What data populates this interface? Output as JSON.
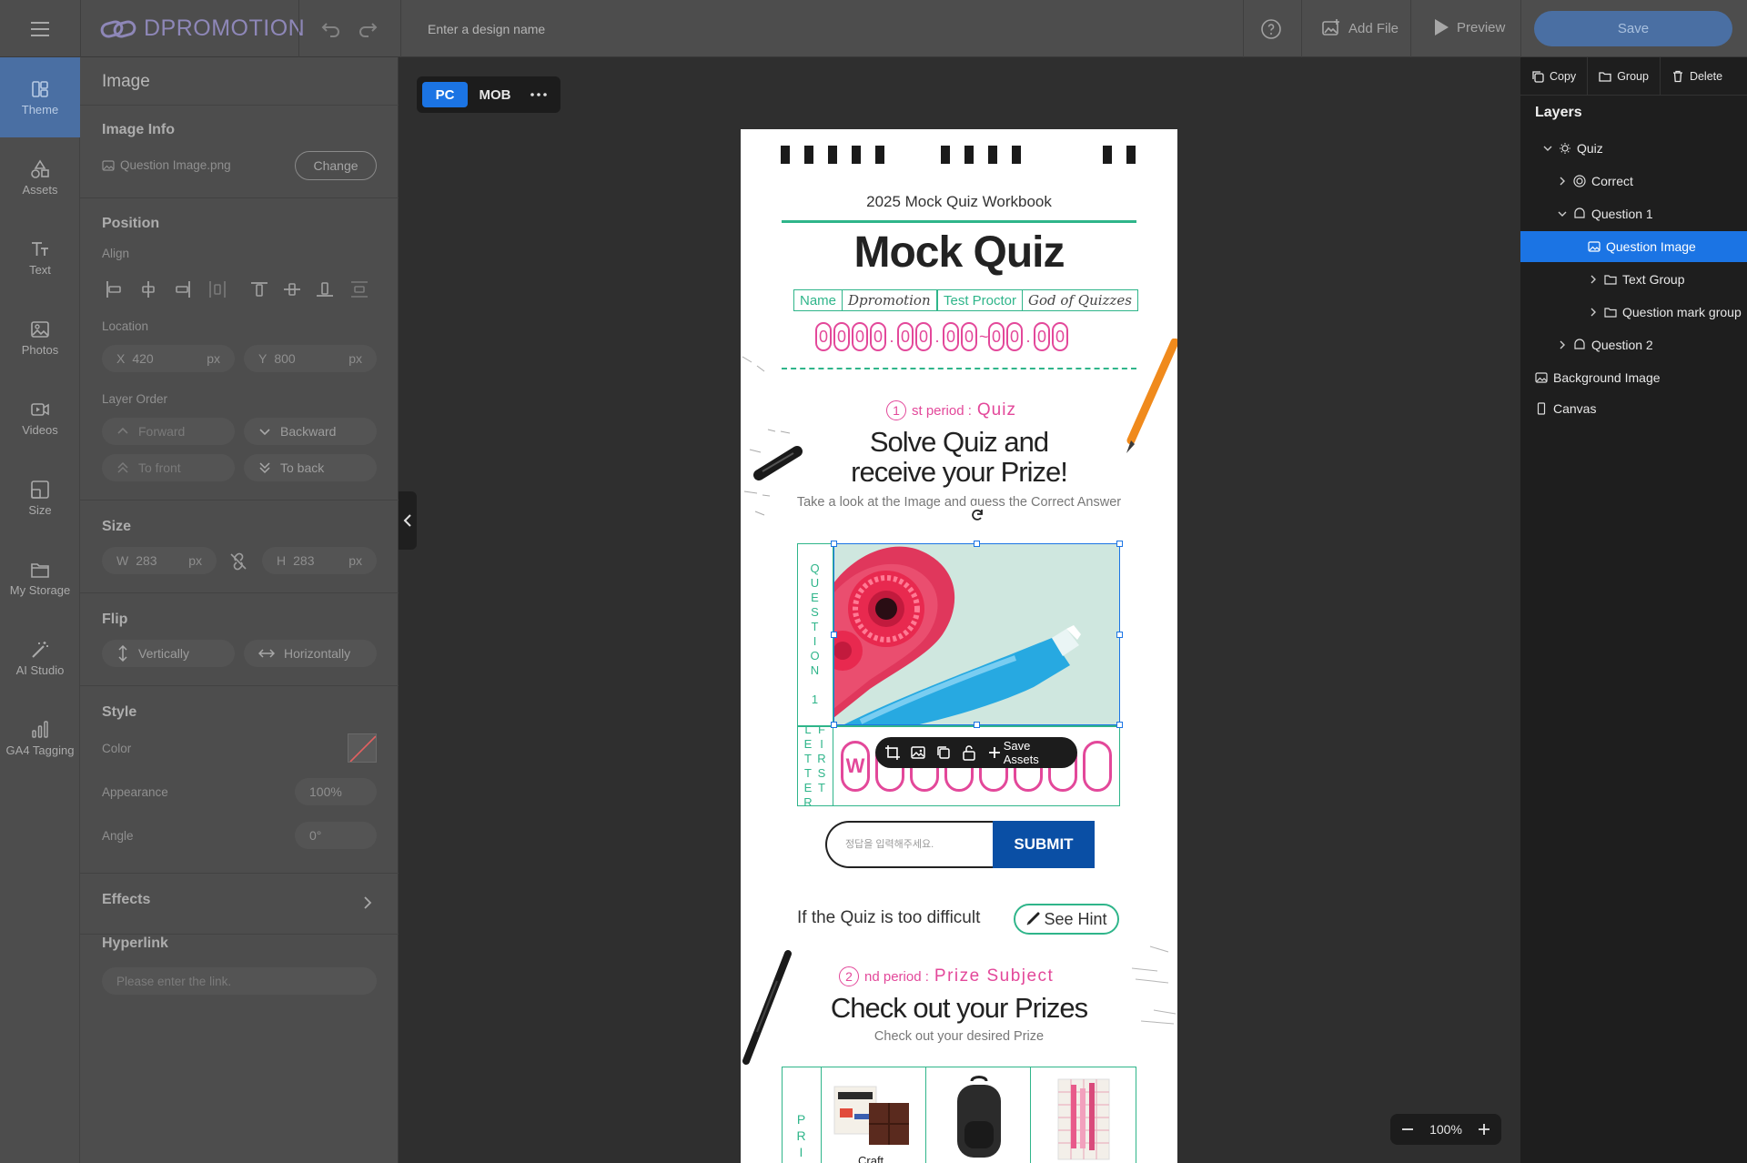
{
  "topbar": {
    "logo_text": "DPROMOTION",
    "design_name_placeholder": "Enter a design name",
    "add_file_label": "Add File",
    "preview_label": "Preview",
    "save_label": "Save"
  },
  "rail": {
    "items": [
      {
        "label": "Theme",
        "icon": "theme-icon"
      },
      {
        "label": "Assets",
        "icon": "assets-icon"
      },
      {
        "label": "Text",
        "icon": "text-icon"
      },
      {
        "label": "Photos",
        "icon": "photos-icon"
      },
      {
        "label": "Videos",
        "icon": "videos-icon"
      },
      {
        "label": "Size",
        "icon": "size-icon"
      },
      {
        "label": "My Storage",
        "icon": "folder-icon"
      },
      {
        "label": "AI Studio",
        "icon": "magic-wand-icon"
      },
      {
        "label": "GA4 Tagging",
        "icon": "bar-chart-icon"
      }
    ],
    "active_index": 0
  },
  "panel": {
    "title": "Image",
    "image_info": {
      "section": "Image Info",
      "file_name": "Question Image.png",
      "change_label": "Change"
    },
    "position": {
      "section": "Position",
      "align_label": "Align",
      "location_label": "Location",
      "x_key": "X",
      "x_value": "420",
      "x_unit": "px",
      "y_key": "Y",
      "y_value": "800",
      "y_unit": "px",
      "layer_order_label": "Layer Order",
      "forward_label": "Forward",
      "backward_label": "Backward",
      "to_front_label": "To front",
      "to_back_label": "To back"
    },
    "size": {
      "section": "Size",
      "w_key": "W",
      "w_value": "283",
      "w_unit": "px",
      "h_key": "H",
      "h_value": "283",
      "h_unit": "px"
    },
    "flip": {
      "section": "Flip",
      "vertical_label": "Vertically",
      "horizontal_label": "Horizontally"
    },
    "style": {
      "section": "Style",
      "color_label": "Color",
      "appearance_label": "Appearance",
      "appearance_value": "100%",
      "angle_label": "Angle",
      "angle_value": "0°"
    },
    "effects_label": "Effects",
    "hyperlink": {
      "section": "Hyperlink",
      "placeholder": "Please enter the link."
    }
  },
  "device": {
    "pc_label": "PC",
    "mob_label": "MOB"
  },
  "canvas": {
    "workbook": "2025 Mock Quiz Workbook",
    "title": "Mock Quiz",
    "name_label": "Name",
    "name_value": "Dpromotion",
    "proctor_label": "Test Proctor",
    "proctor_value": "God of Quizzes",
    "date_groups": [
      [
        "0",
        "0",
        "0",
        "0"
      ],
      [
        "0",
        "0"
      ],
      [
        "0",
        "0"
      ],
      [
        "0",
        "0"
      ],
      [
        "0",
        "0"
      ]
    ],
    "date_seps": [
      ".",
      ".",
      "~",
      "."
    ],
    "period1_num": "1",
    "period1_small": "st period :",
    "period1_big": "Quiz",
    "headline_1": "Solve Quiz and",
    "headline_2": "receive your Prize!",
    "take_look": "Take a look at the Image and guess the Correct Answer",
    "question_vertical": "QUESTION 1",
    "first_letter_vertical": "FIRST LETTER",
    "first_letter": "W",
    "save_assets_label": "Save Assets",
    "answer_placeholder": "정답을 입력해주세요.",
    "submit_label": "SUBMIT",
    "difficult_text": "If the Quiz is too difficult",
    "hint_label": "See Hint",
    "period2_num": "2",
    "period2_small": "nd period :",
    "period2_big": "Prize Subject",
    "checkout_title": "Check out your Prizes",
    "checkout_sub": "Check out your desired Prize",
    "prize_vertical": "PRIZ",
    "prize_1_label": "Craft"
  },
  "zoom": {
    "value": "100%"
  },
  "layers_panel": {
    "copy_label": "Copy",
    "group_label": "Group",
    "delete_label": "Delete",
    "title": "Layers",
    "items": [
      {
        "label": "Quiz",
        "icon": "bulb-icon"
      },
      {
        "label": "Correct",
        "icon": "target-icon"
      },
      {
        "label": "Question 1",
        "icon": "chat-icon"
      },
      {
        "label": "Question Image",
        "icon": "image-icon"
      },
      {
        "label": "Text Group",
        "icon": "folder-icon"
      },
      {
        "label": "Question mark group",
        "icon": "folder-icon"
      },
      {
        "label": "Question 2",
        "icon": "chat-icon"
      },
      {
        "label": "Background Image",
        "icon": "image-icon"
      },
      {
        "label": "Canvas",
        "icon": "rectangle-icon"
      }
    ],
    "selected_index": 3
  },
  "colors": {
    "accent": "#1b74e4",
    "quiz_green": "#2fb58a",
    "quiz_pink": "#e3489a",
    "submit_blue": "#0a4fa5"
  }
}
